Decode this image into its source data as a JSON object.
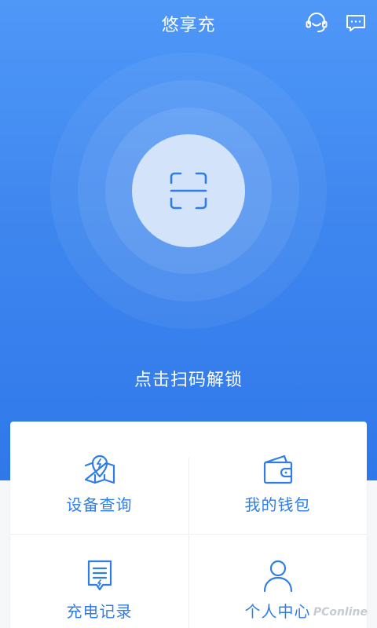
{
  "header": {
    "title": "悠享充",
    "icons": [
      "customer-service-icon",
      "message-icon"
    ]
  },
  "scan": {
    "label": "点击扫码解锁",
    "icon": "scan-icon"
  },
  "menu": {
    "items": [
      {
        "label": "设备查询",
        "icon": "map-pin-icon"
      },
      {
        "label": "我的钱包",
        "icon": "wallet-icon"
      },
      {
        "label": "充电记录",
        "icon": "record-icon"
      },
      {
        "label": "个人中心",
        "icon": "person-icon"
      }
    ]
  },
  "watermark": "PConline",
  "colors": {
    "primary": "#3f87ef",
    "accent_text": "#2f7ee8",
    "scan_circle": "#d3e3f9"
  }
}
